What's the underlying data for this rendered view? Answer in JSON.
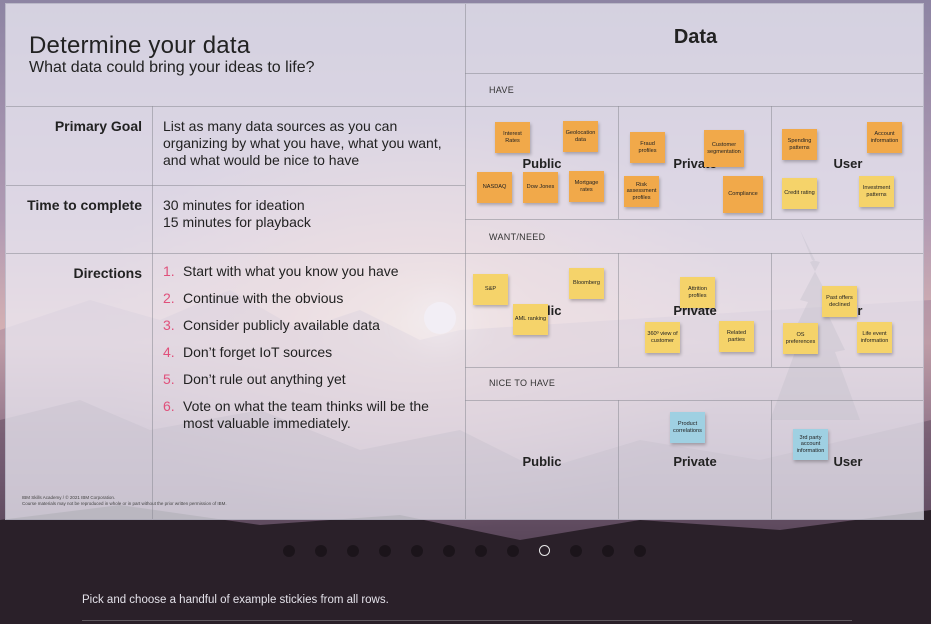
{
  "left": {
    "title": "Determine your data",
    "subtitle": "What data could bring your ideas to life?",
    "primary_goal_label": "Primary Goal",
    "primary_goal_text": "List as many data sources as you can organizing by what you have, what you want, and what would be nice to have",
    "time_label": "Time to complete",
    "time_line1": "30 minutes for ideation",
    "time_line2": "15 minutes for playback",
    "directions_label": "Directions",
    "directions": [
      {
        "n": "1.",
        "text": "Start with what you know you have"
      },
      {
        "n": "2.",
        "text": "Continue with the obvious"
      },
      {
        "n": "3.",
        "text": "Consider publicly available data"
      },
      {
        "n": "4.",
        "text": "Don’t forget IoT sources"
      },
      {
        "n": "5.",
        "text": "Don’t rule out anything yet"
      },
      {
        "n": "6.",
        "text": "Vote on what the team thinks will be the most valuable immediately."
      }
    ],
    "footer_line1": "IBM Skills Academy / © 2021 IBM Corporation.",
    "footer_line2": "Course materials may not be reproduced in whole or in part without the prior written permission of IBM."
  },
  "right": {
    "title": "Data",
    "sections": [
      "HAVE",
      "WANT/NEED",
      "NICE TO HAVE"
    ],
    "categories": [
      "Public",
      "Private",
      "User"
    ]
  },
  "stickies": {
    "have_public": [
      "Interest Rates",
      "Geolocation data",
      "NASDAQ",
      "Dow Jones",
      "Mortgage rates"
    ],
    "have_private": [
      "Fraud profiles",
      "Customer segmentation",
      "Risk assessment profiles",
      "Compliance"
    ],
    "have_user": [
      "Spending patterns",
      "Account information",
      "Credit rating",
      "Investment patterns"
    ],
    "want_public": [
      "S&P",
      "Bloomberg",
      "AML ranking"
    ],
    "want_private": [
      "Attrition profiles",
      "360º view of customer",
      "Related parties"
    ],
    "want_user": [
      "Past offers declined",
      "OS preferences",
      "Life event information"
    ],
    "nice_private": [
      "Product correlations"
    ],
    "nice_user": [
      "3rd party account information"
    ]
  },
  "carousel": {
    "count": 12,
    "active_index": 8
  },
  "caption": "Pick and choose a handful of example stickies from all rows.",
  "colors": {
    "orange": "#f1a94a",
    "yellow": "#f5d36a",
    "blue": "#9fd0e2",
    "step_number": "#e0507b"
  }
}
